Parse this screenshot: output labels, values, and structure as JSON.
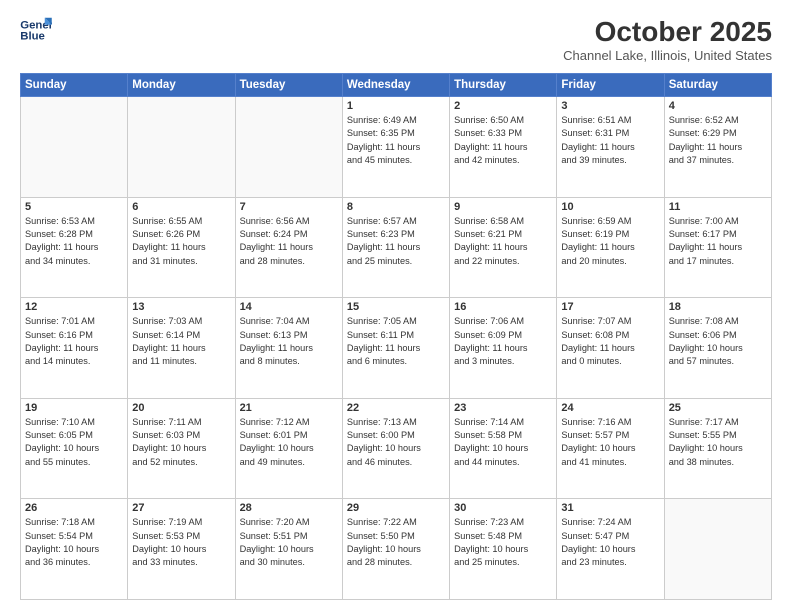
{
  "header": {
    "logo_line1": "General",
    "logo_line2": "Blue",
    "month_title": "October 2025",
    "location": "Channel Lake, Illinois, United States"
  },
  "weekdays": [
    "Sunday",
    "Monday",
    "Tuesday",
    "Wednesday",
    "Thursday",
    "Friday",
    "Saturday"
  ],
  "weeks": [
    [
      {
        "day": "",
        "info": ""
      },
      {
        "day": "",
        "info": ""
      },
      {
        "day": "",
        "info": ""
      },
      {
        "day": "1",
        "info": "Sunrise: 6:49 AM\nSunset: 6:35 PM\nDaylight: 11 hours\nand 45 minutes."
      },
      {
        "day": "2",
        "info": "Sunrise: 6:50 AM\nSunset: 6:33 PM\nDaylight: 11 hours\nand 42 minutes."
      },
      {
        "day": "3",
        "info": "Sunrise: 6:51 AM\nSunset: 6:31 PM\nDaylight: 11 hours\nand 39 minutes."
      },
      {
        "day": "4",
        "info": "Sunrise: 6:52 AM\nSunset: 6:29 PM\nDaylight: 11 hours\nand 37 minutes."
      }
    ],
    [
      {
        "day": "5",
        "info": "Sunrise: 6:53 AM\nSunset: 6:28 PM\nDaylight: 11 hours\nand 34 minutes."
      },
      {
        "day": "6",
        "info": "Sunrise: 6:55 AM\nSunset: 6:26 PM\nDaylight: 11 hours\nand 31 minutes."
      },
      {
        "day": "7",
        "info": "Sunrise: 6:56 AM\nSunset: 6:24 PM\nDaylight: 11 hours\nand 28 minutes."
      },
      {
        "day": "8",
        "info": "Sunrise: 6:57 AM\nSunset: 6:23 PM\nDaylight: 11 hours\nand 25 minutes."
      },
      {
        "day": "9",
        "info": "Sunrise: 6:58 AM\nSunset: 6:21 PM\nDaylight: 11 hours\nand 22 minutes."
      },
      {
        "day": "10",
        "info": "Sunrise: 6:59 AM\nSunset: 6:19 PM\nDaylight: 11 hours\nand 20 minutes."
      },
      {
        "day": "11",
        "info": "Sunrise: 7:00 AM\nSunset: 6:17 PM\nDaylight: 11 hours\nand 17 minutes."
      }
    ],
    [
      {
        "day": "12",
        "info": "Sunrise: 7:01 AM\nSunset: 6:16 PM\nDaylight: 11 hours\nand 14 minutes."
      },
      {
        "day": "13",
        "info": "Sunrise: 7:03 AM\nSunset: 6:14 PM\nDaylight: 11 hours\nand 11 minutes."
      },
      {
        "day": "14",
        "info": "Sunrise: 7:04 AM\nSunset: 6:13 PM\nDaylight: 11 hours\nand 8 minutes."
      },
      {
        "day": "15",
        "info": "Sunrise: 7:05 AM\nSunset: 6:11 PM\nDaylight: 11 hours\nand 6 minutes."
      },
      {
        "day": "16",
        "info": "Sunrise: 7:06 AM\nSunset: 6:09 PM\nDaylight: 11 hours\nand 3 minutes."
      },
      {
        "day": "17",
        "info": "Sunrise: 7:07 AM\nSunset: 6:08 PM\nDaylight: 11 hours\nand 0 minutes."
      },
      {
        "day": "18",
        "info": "Sunrise: 7:08 AM\nSunset: 6:06 PM\nDaylight: 10 hours\nand 57 minutes."
      }
    ],
    [
      {
        "day": "19",
        "info": "Sunrise: 7:10 AM\nSunset: 6:05 PM\nDaylight: 10 hours\nand 55 minutes."
      },
      {
        "day": "20",
        "info": "Sunrise: 7:11 AM\nSunset: 6:03 PM\nDaylight: 10 hours\nand 52 minutes."
      },
      {
        "day": "21",
        "info": "Sunrise: 7:12 AM\nSunset: 6:01 PM\nDaylight: 10 hours\nand 49 minutes."
      },
      {
        "day": "22",
        "info": "Sunrise: 7:13 AM\nSunset: 6:00 PM\nDaylight: 10 hours\nand 46 minutes."
      },
      {
        "day": "23",
        "info": "Sunrise: 7:14 AM\nSunset: 5:58 PM\nDaylight: 10 hours\nand 44 minutes."
      },
      {
        "day": "24",
        "info": "Sunrise: 7:16 AM\nSunset: 5:57 PM\nDaylight: 10 hours\nand 41 minutes."
      },
      {
        "day": "25",
        "info": "Sunrise: 7:17 AM\nSunset: 5:55 PM\nDaylight: 10 hours\nand 38 minutes."
      }
    ],
    [
      {
        "day": "26",
        "info": "Sunrise: 7:18 AM\nSunset: 5:54 PM\nDaylight: 10 hours\nand 36 minutes."
      },
      {
        "day": "27",
        "info": "Sunrise: 7:19 AM\nSunset: 5:53 PM\nDaylight: 10 hours\nand 33 minutes."
      },
      {
        "day": "28",
        "info": "Sunrise: 7:20 AM\nSunset: 5:51 PM\nDaylight: 10 hours\nand 30 minutes."
      },
      {
        "day": "29",
        "info": "Sunrise: 7:22 AM\nSunset: 5:50 PM\nDaylight: 10 hours\nand 28 minutes."
      },
      {
        "day": "30",
        "info": "Sunrise: 7:23 AM\nSunset: 5:48 PM\nDaylight: 10 hours\nand 25 minutes."
      },
      {
        "day": "31",
        "info": "Sunrise: 7:24 AM\nSunset: 5:47 PM\nDaylight: 10 hours\nand 23 minutes."
      },
      {
        "day": "",
        "info": ""
      }
    ]
  ]
}
